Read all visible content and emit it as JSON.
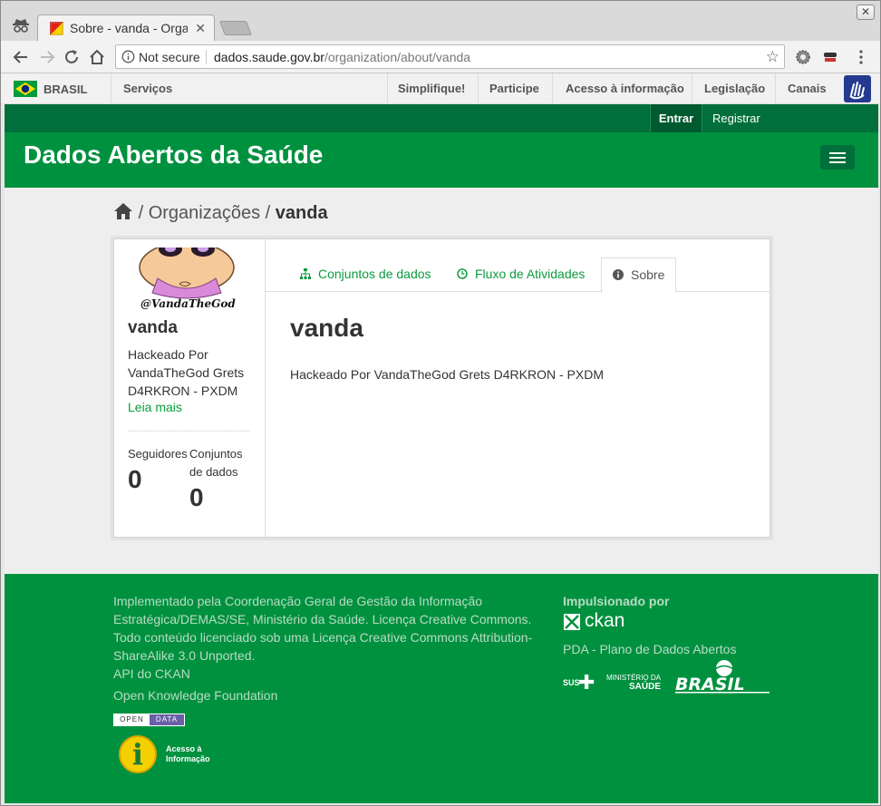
{
  "browser": {
    "tab_title": "Sobre - vanda - Organizações",
    "security_label": "Not secure",
    "url_host": "dados.saude.gov.br",
    "url_path": "/organization/about/vanda"
  },
  "govbar": {
    "brand": "BRASIL",
    "servicos": "Serviços",
    "links": [
      "Simplifique!",
      "Participe",
      "Acesso à informação",
      "Legislação",
      "Canais"
    ]
  },
  "account": {
    "login": "Entrar",
    "register": "Registrar"
  },
  "site": {
    "title": "Dados Abertos da Saúde"
  },
  "breadcrumb": {
    "sep1": "/",
    "organizacoes": "Organizações",
    "sep2": "/",
    "current": "vanda"
  },
  "org": {
    "avatar_caption": "@VandaTheGod",
    "name": "vanda",
    "description": "Hackeado Por VandaTheGod Grets D4RKRON - PXDM",
    "read_more": "Leia mais",
    "followers_label": "Seguidores",
    "followers": "0",
    "datasets_label": "Conjuntos de dados",
    "datasets": "0"
  },
  "tabs": [
    {
      "label": "Conjuntos de dados",
      "icon": "sitemap-icon"
    },
    {
      "label": "Fluxo de Atividades",
      "icon": "clock-icon"
    },
    {
      "label": "Sobre",
      "icon": "info-icon"
    }
  ],
  "about": {
    "heading": "vanda",
    "text": "Hackeado Por VandaTheGod Grets D4RKRON - PXDM"
  },
  "footer": {
    "credits": "Implementado pela Coordenação Geral de Gestão da Informação Estratégica/DEMAS/SE, Ministério da Saúde. Licença Creative Commons. Todo conteúdo licenciado sob uma Licença Creative Commons Attribution-ShareAlike 3.0 Unported.",
    "api": "API do CKAN",
    "okf": "Open Knowledge Foundation",
    "open_data_left": "OPEN",
    "open_data_right": "DATA",
    "acesso_line1": "Acesso à",
    "acesso_line2": "Informação",
    "powered_by": "Impulsionado por",
    "ckan": "ckan",
    "pda": "PDA - Plano de Dados Abertos",
    "sus": "SUS",
    "ministerio": "MINISTÉRIO DA",
    "saude": "SAÚDE"
  },
  "colors": {
    "primary_green": "#00913f",
    "dark_green": "#006f3b",
    "link_green": "#0b9c3e"
  }
}
